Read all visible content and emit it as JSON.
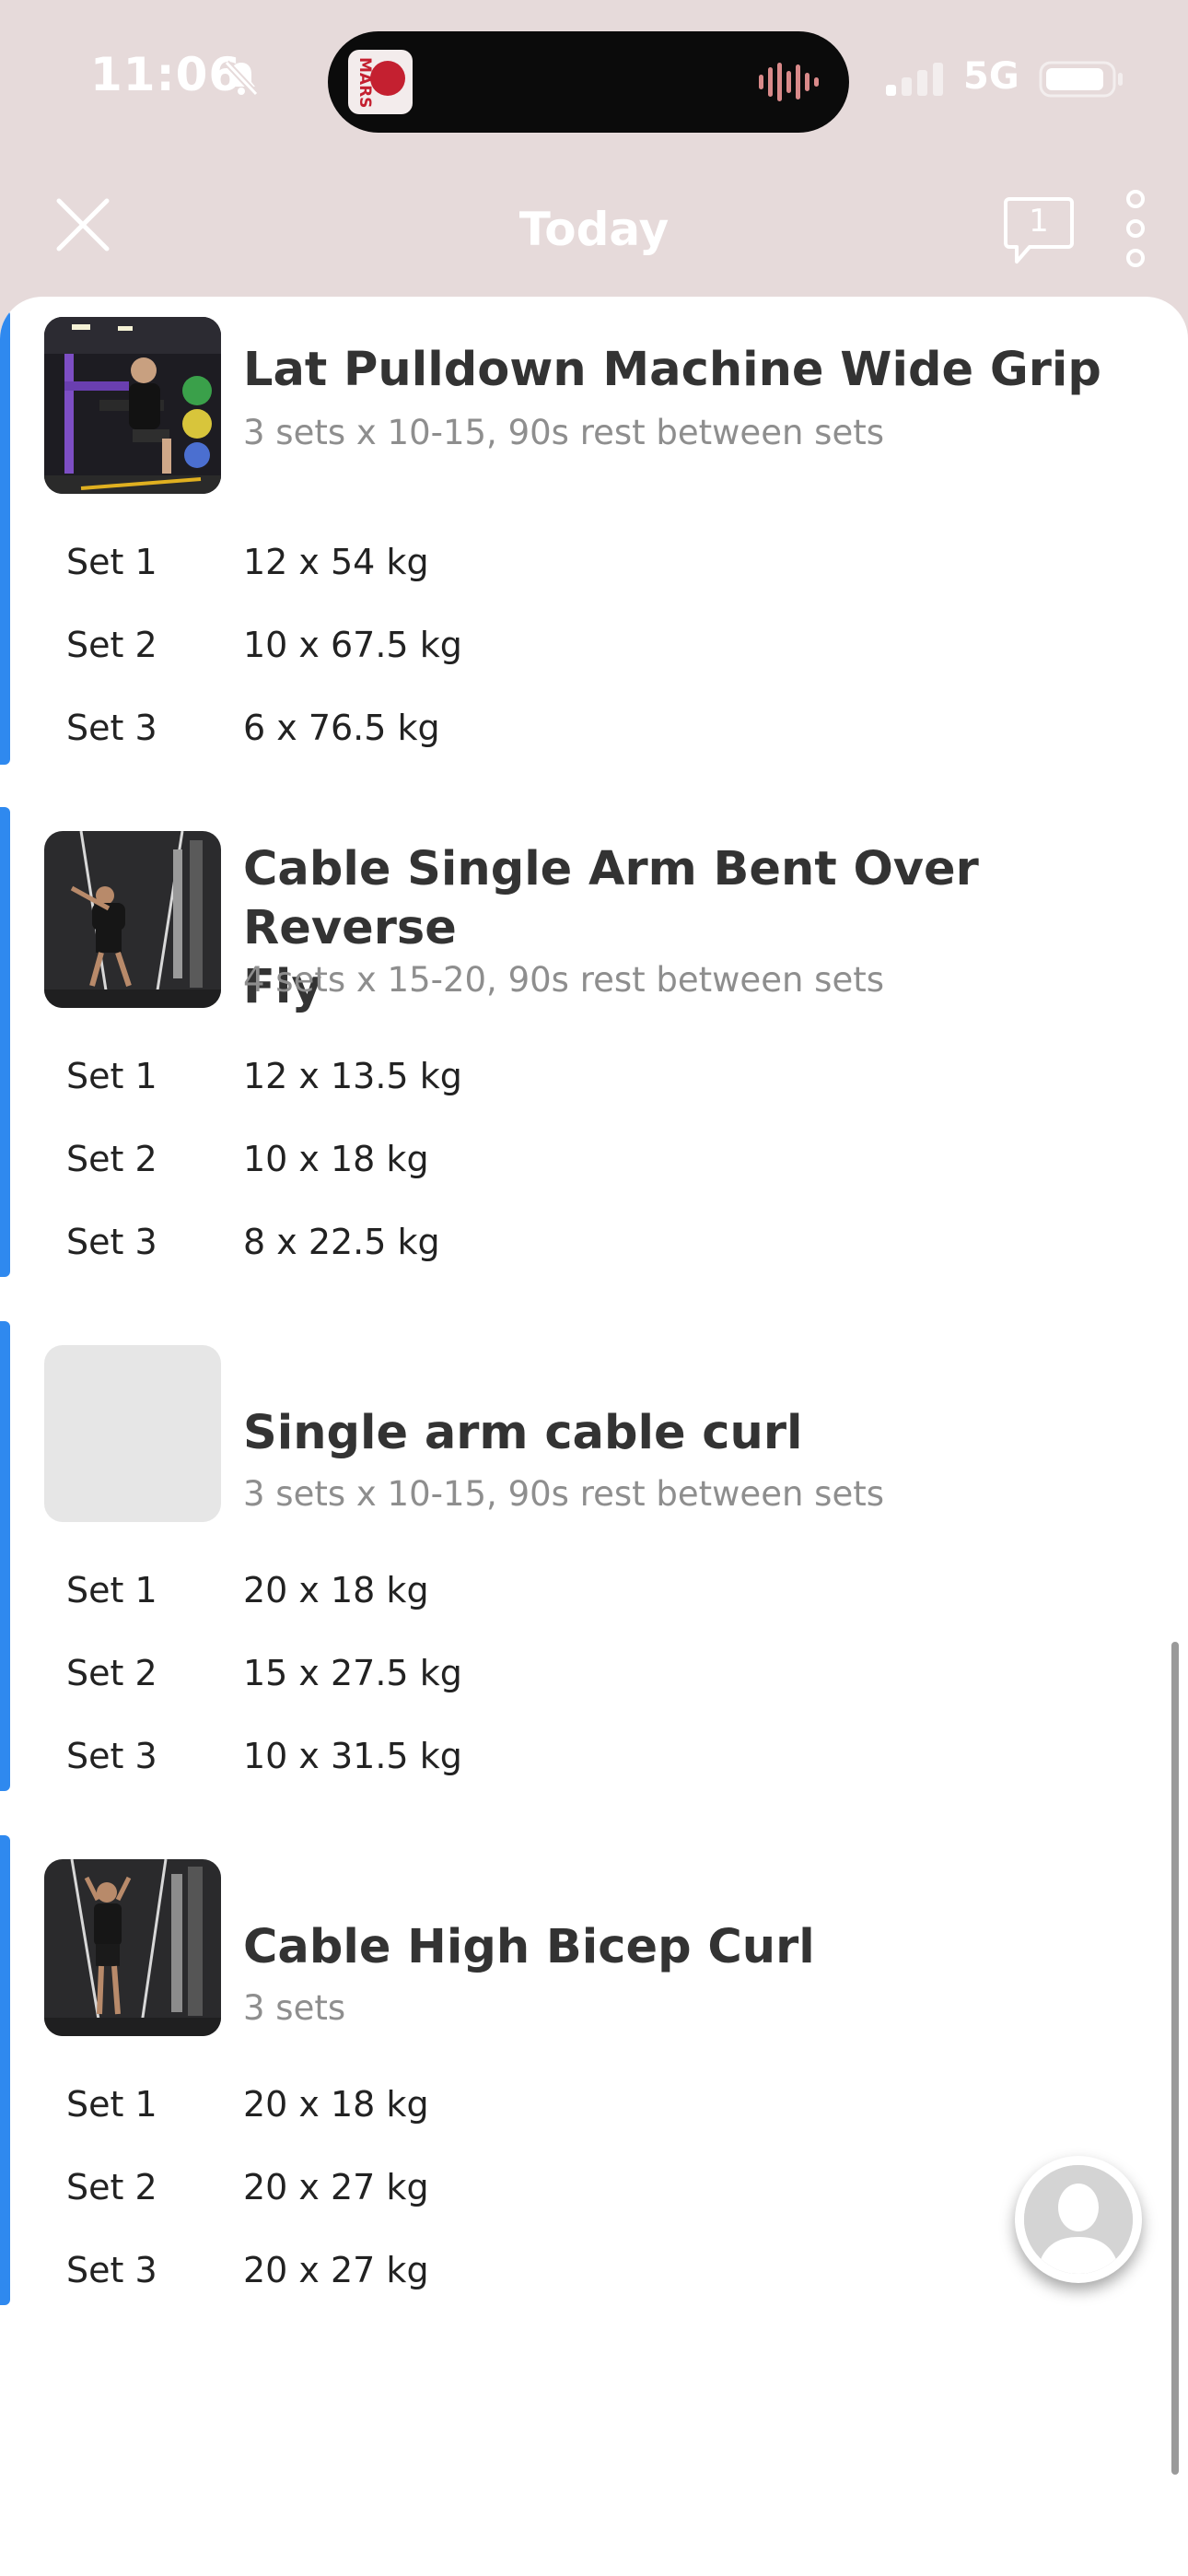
{
  "status_bar": {
    "time": "11:06",
    "network": "5G"
  },
  "island_app_text": "MARS",
  "nav": {
    "title": "Today",
    "comments_count": "1"
  },
  "exercises": [
    {
      "title": "Lat Pulldown Machine Wide Grip",
      "subtitle": "3 sets x 10-15, 90s rest between sets",
      "sets": [
        {
          "label": "Set 1",
          "value": "12 x 54 kg"
        },
        {
          "label": "Set 2",
          "value": "10 x 67.5 kg"
        },
        {
          "label": "Set 3",
          "value": "6 x 76.5 kg"
        }
      ]
    },
    {
      "title_line1": "Cable Single Arm Bent Over Reverse",
      "title_line2": "Fly",
      "subtitle": "4 sets x 15-20, 90s rest between sets",
      "sets": [
        {
          "label": "Set 1",
          "value": "12 x 13.5 kg"
        },
        {
          "label": "Set 2",
          "value": "10 x 18 kg"
        },
        {
          "label": "Set 3",
          "value": "8 x 22.5 kg"
        }
      ]
    },
    {
      "title": "Single arm cable curl",
      "subtitle": "3 sets x 10-15, 90s rest between sets",
      "sets": [
        {
          "label": "Set 1",
          "value": "20 x 18 kg"
        },
        {
          "label": "Set 2",
          "value": "15 x 27.5 kg"
        },
        {
          "label": "Set 3",
          "value": "10 x 31.5 kg"
        }
      ]
    },
    {
      "title": "Cable High Bicep Curl",
      "subtitle": "3 sets",
      "sets": [
        {
          "label": "Set 1",
          "value": "20 x 18 kg"
        },
        {
          "label": "Set 2",
          "value": "20 x 27 kg"
        },
        {
          "label": "Set 3",
          "value": "20 x 27 kg"
        }
      ]
    }
  ],
  "colors": {
    "accent": "#2f89ef",
    "header_bg": "#e6dada"
  },
  "icons": [
    "bell-off-icon",
    "waveform-icon",
    "signal-icon",
    "battery-icon",
    "close-icon",
    "comment-icon",
    "more-icon",
    "avatar-icon"
  ]
}
